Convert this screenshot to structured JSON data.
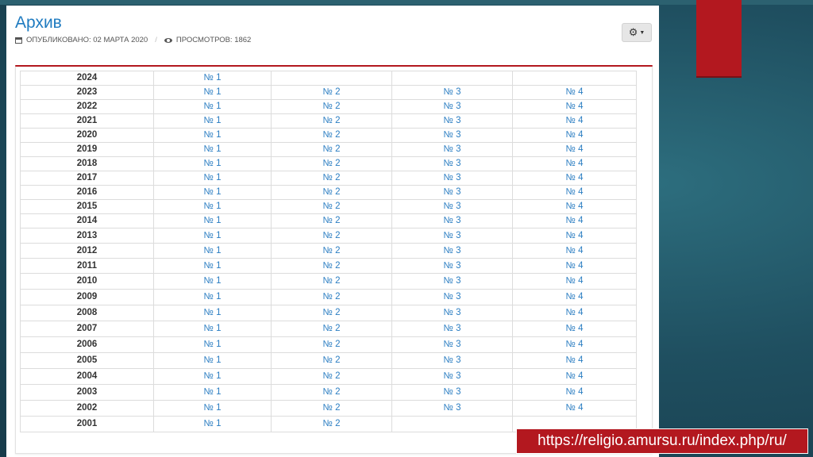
{
  "page": {
    "title": "Архив",
    "published_label": "ОПУБЛИКОВАНО: 02 МАРТА 2020",
    "views_label": "ПРОСМОТРОВ: 1862",
    "separator": "/",
    "gear_icon": "gear-icon",
    "url_label": "https://religio.amursu.ru/index.php/ru/"
  },
  "colors": {
    "accent_red": "#b3181f",
    "link_blue": "#2a7dc2",
    "title_blue": "#1f7bc0",
    "background_teal": "#1f4f60"
  },
  "archive": {
    "rows": [
      {
        "year": "2024",
        "issues": [
          "№ 1"
        ]
      },
      {
        "year": "2023",
        "issues": [
          "№ 1",
          "№ 2",
          "№ 3",
          "№ 4"
        ]
      },
      {
        "year": "2022",
        "issues": [
          "№ 1",
          "№ 2",
          "№ 3",
          "№ 4"
        ]
      },
      {
        "year": "2021",
        "issues": [
          "№ 1",
          "№ 2",
          "№ 3",
          "№ 4"
        ]
      },
      {
        "year": "2020",
        "issues": [
          "№ 1",
          "№ 2",
          "№ 3",
          "№ 4"
        ]
      },
      {
        "year": "2019",
        "issues": [
          "№ 1",
          "№ 2",
          "№ 3",
          "№ 4"
        ]
      },
      {
        "year": "2018",
        "issues": [
          "№ 1",
          "№ 2",
          "№ 3",
          "№ 4"
        ]
      },
      {
        "year": "2017",
        "issues": [
          "№ 1",
          "№ 2",
          "№ 3",
          "№ 4"
        ]
      },
      {
        "year": "2016",
        "issues": [
          "№ 1",
          "№ 2",
          "№ 3",
          "№ 4"
        ]
      },
      {
        "year": "2015",
        "issues": [
          "№ 1",
          "№ 2",
          "№ 3",
          "№ 4"
        ]
      },
      {
        "year": "2014",
        "issues": [
          "№ 1",
          "№ 2",
          "№ 3",
          "№ 4"
        ]
      },
      {
        "year": "2013",
        "issues": [
          "№ 1",
          "№ 2",
          "№ 3",
          "№ 4"
        ]
      },
      {
        "year": "2012",
        "issues": [
          "№ 1",
          "№ 2",
          "№ 3",
          "№ 4"
        ]
      },
      {
        "year": "2011",
        "issues": [
          "№ 1",
          "№ 2",
          "№ 3",
          "№ 4"
        ]
      },
      {
        "year": "2010",
        "issues": [
          "№ 1",
          "№ 2",
          "№ 3",
          "№ 4"
        ]
      },
      {
        "year": "2009",
        "issues": [
          "№ 1",
          "№ 2",
          "№ 3",
          "№ 4"
        ]
      },
      {
        "year": "2008",
        "issues": [
          "№ 1",
          "№ 2",
          "№ 3",
          "№ 4"
        ]
      },
      {
        "year": "2007",
        "issues": [
          "№ 1",
          "№ 2",
          "№ 3",
          "№ 4"
        ]
      },
      {
        "year": "2006",
        "issues": [
          "№ 1",
          "№ 2",
          "№ 3",
          "№ 4"
        ]
      },
      {
        "year": "2005",
        "issues": [
          "№ 1",
          "№ 2",
          "№ 3",
          "№ 4"
        ]
      },
      {
        "year": "2004",
        "issues": [
          "№ 1",
          "№ 2",
          "№ 3",
          "№ 4"
        ]
      },
      {
        "year": "2003",
        "issues": [
          "№ 1",
          "№ 2",
          "№ 3",
          "№ 4"
        ]
      },
      {
        "year": "2002",
        "issues": [
          "№ 1",
          "№ 2",
          "№ 3",
          "№ 4"
        ]
      },
      {
        "year": "2001",
        "issues": [
          "№ 1",
          "№ 2"
        ]
      }
    ]
  }
}
